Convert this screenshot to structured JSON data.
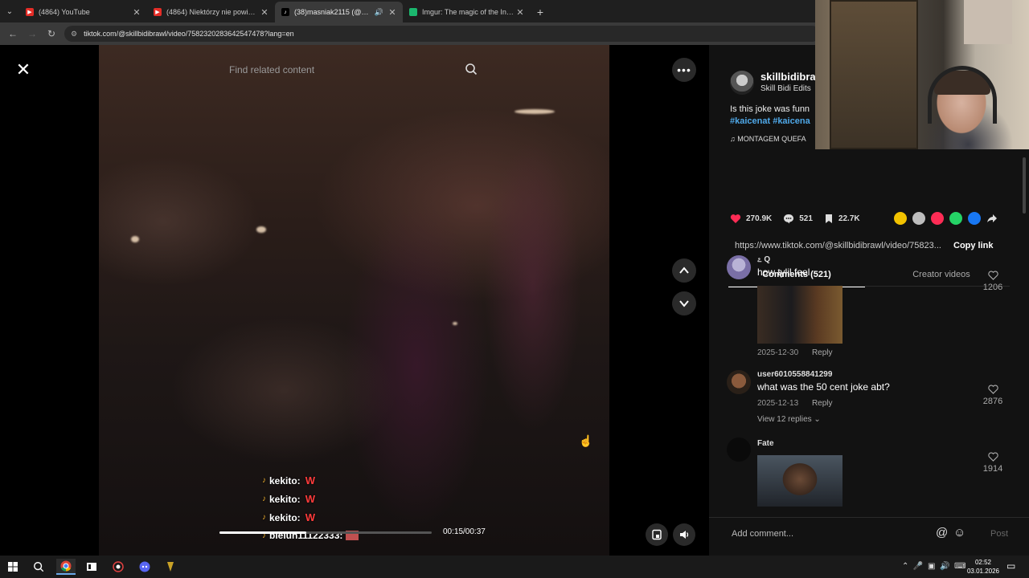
{
  "browser": {
    "tabs": [
      {
        "title": "(4864) YouTube",
        "favicon_color": "#e52d27",
        "active": false,
        "audio": false
      },
      {
        "title": "(4864) Niektórzy nie powinni m",
        "favicon_color": "#e52d27",
        "active": false,
        "audio": false
      },
      {
        "title": "(38)masniak2115 (@masnia",
        "favicon_color": "#000000",
        "active": true,
        "audio": true
      },
      {
        "title": "Imgur: The magic of the Interne",
        "favicon_color": "#1bb76e",
        "active": false,
        "audio": false
      }
    ],
    "url": "tiktok.com/@skillbidibrawl/video/7582320283642547478?lang=en"
  },
  "video": {
    "search_placeholder": "Find related content",
    "progress_fraction": 0.41,
    "time": "00:15/00:37",
    "chat": [
      {
        "user": "kekito:",
        "msg": "W"
      },
      {
        "user": "kekito:",
        "msg": "W"
      },
      {
        "user": "kekito:",
        "msg": "W"
      },
      {
        "user": "bieluh11122333:",
        "msg": ""
      }
    ]
  },
  "post": {
    "author_name": "skillbidibra",
    "author_sub": "Skill Bidi Edits",
    "description": "Is this joke was funn",
    "tags": "#kaicenat #kaicena",
    "music": "♫  MONTAGEM QUEFA",
    "likes": "270.9K",
    "comments_count": "521",
    "saves": "22.7K",
    "link": "https://www.tiktok.com/@skillbidibrawl/video/75823...",
    "copy_link": "Copy link",
    "share_colors": [
      "#f2c200",
      "#bdbdbd",
      "#fe2c55",
      "#25d366",
      "#1877f2"
    ]
  },
  "panel_tabs": {
    "comments": "Comments (521)",
    "creator": "Creator videos"
  },
  "comments": [
    {
      "user": "೭ Q",
      "text": "how tylil feel",
      "date": "2025-12-30",
      "reply": "Reply",
      "likes": "1206"
    },
    {
      "user": "user6010558841299",
      "text": "what was the 50 cent joke abt?",
      "date": "2025-12-13",
      "reply": "Reply",
      "likes": "2876",
      "view_replies": "View 12 replies"
    },
    {
      "user": "Fate",
      "text": "",
      "likes": "1914"
    }
  ],
  "composer": {
    "placeholder": "Add comment...",
    "post": "Post"
  },
  "taskbar": {
    "time": "02:52",
    "date": "03.01.2026"
  }
}
